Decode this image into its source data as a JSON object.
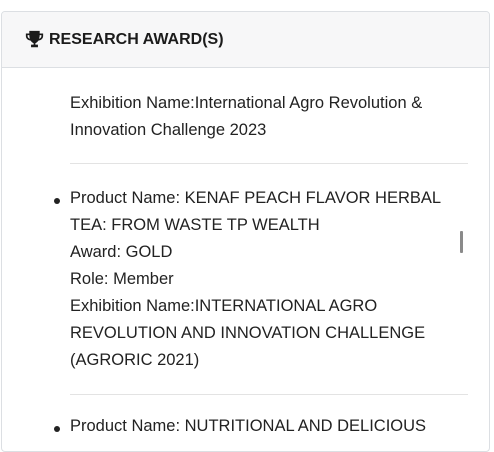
{
  "card": {
    "icon": "trophy-icon",
    "title": "RESEARCH AWARD(S)"
  },
  "awards": [
    {
      "exhibition": "Exhibition Name:International Agro Revolution & Innovation Challenge 2023"
    },
    {
      "product": "Product Name: KENAF PEACH FLAVOR HERBAL TEA: FROM WASTE TP WEALTH",
      "award": "Award: GOLD",
      "role": "Role: Member",
      "exhibition": "Exhibition Name:INTERNATIONAL AGRO REVOLUTION AND INNOVATION CHALLENGE (AGRORIC 2021)"
    },
    {
      "product": "Product Name: NUTRITIONAL AND DELICIOUS"
    }
  ],
  "colors": {
    "header_bg": "#f7f7f8",
    "border": "#dcdfe3",
    "text": "#222222"
  }
}
